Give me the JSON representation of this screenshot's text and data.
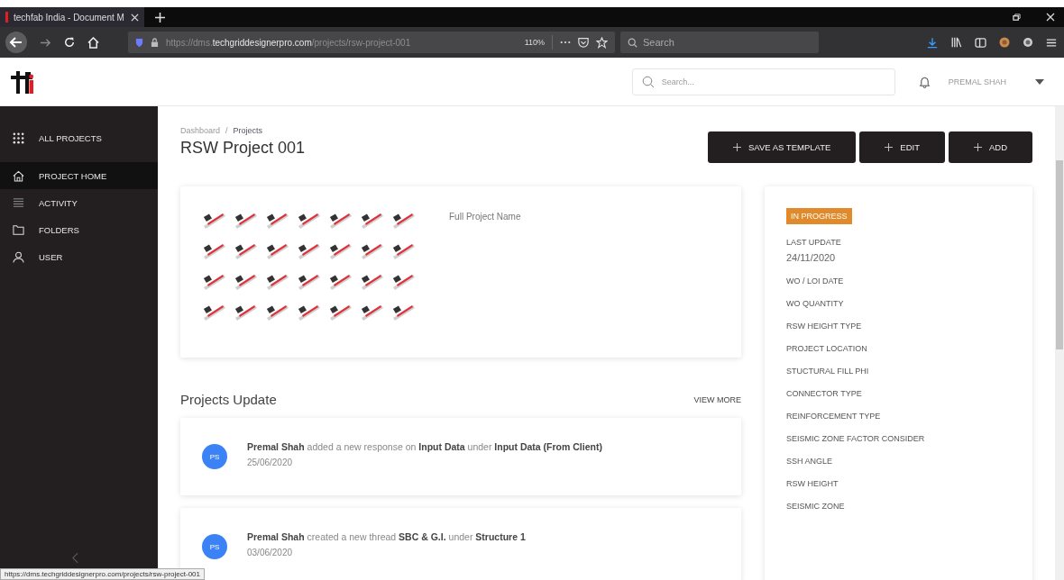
{
  "browser": {
    "tab_title": "techfab India - Document M",
    "url": {
      "scheme": "https://dms.",
      "domain": "techgriddesignerpro.com",
      "path": "/projects/rsw-project-001"
    },
    "zoom": "110%",
    "search_placeholder": "Search",
    "status_url": "https://dms.techgriddesignerpro.com/projects/rsw-project-001"
  },
  "header": {
    "search_placeholder": "Search...",
    "user": "PREMAL SHAH"
  },
  "sidebar": {
    "items": [
      {
        "kind": "grid",
        "label": "ALL PROJECTS",
        "selected": false
      },
      {
        "kind": "home",
        "label": "PROJECT HOME",
        "selected": true
      },
      {
        "kind": "list",
        "label": "ACTIVITY",
        "selected": false
      },
      {
        "kind": "folder",
        "label": "FOLDERS",
        "selected": false
      },
      {
        "kind": "user",
        "label": "USER",
        "selected": false
      }
    ]
  },
  "breadcrumb": {
    "separator": "/",
    "items": [
      "Dashboard",
      "Projects"
    ]
  },
  "title": "RSW Project 001",
  "buttons": [
    "SAVE AS TEMPLATE",
    "EDIT",
    "ADD"
  ],
  "overview": {
    "full_name_label": "Full Project Name"
  },
  "updates": {
    "title": "Projects Update",
    "view_more": "VIEW MORE",
    "items": [
      {
        "avatar": "PS",
        "text": "**Premal Shah** added a new response on **Input Data** under **Input Data (From Client)**",
        "date": "25/06/2020"
      },
      {
        "avatar": "PS",
        "text": "**Premal Shah** created a new thread **SBC & G.I.** under **Structure 1**",
        "date": "03/06/2020"
      }
    ]
  },
  "details": {
    "status": "IN PROGRESS",
    "fields": [
      {
        "label": "LAST UPDATE",
        "value": "24/11/2020"
      },
      {
        "label": "WO / LOI DATE"
      },
      {
        "label": "WO QUANTITY"
      },
      {
        "label": "RSW HEIGHT TYPE"
      },
      {
        "label": "PROJECT LOCATION"
      },
      {
        "label": "STUCTURAL FILL PHI"
      },
      {
        "label": "CONNECTOR TYPE"
      },
      {
        "label": "REINFORCEMENT TYPE"
      },
      {
        "label": "SEISMIC ZONE FACTOR CONSIDER"
      },
      {
        "label": "SSH ANGLE"
      },
      {
        "label": "RSW HEIGHT"
      },
      {
        "label": "SEISMIC ZONE"
      }
    ]
  }
}
